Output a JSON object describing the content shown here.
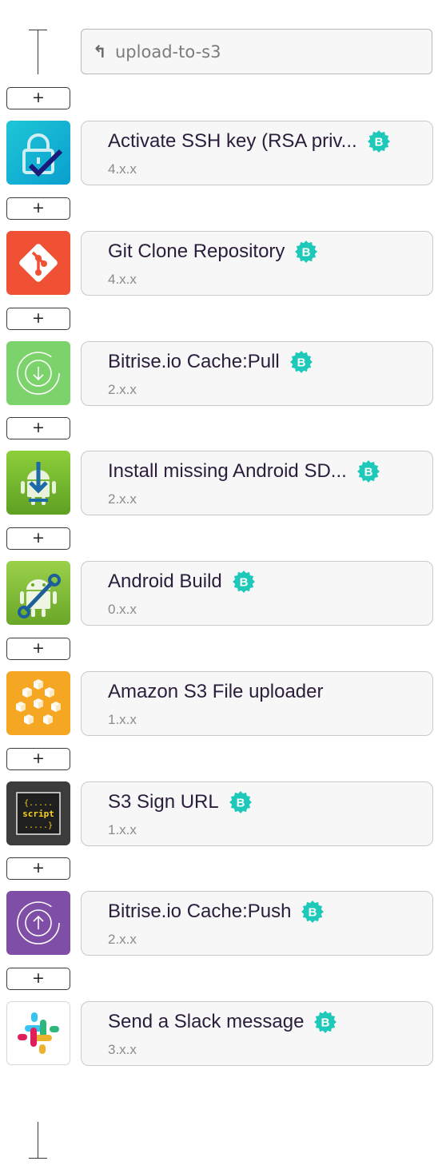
{
  "workflow": {
    "name": "upload-to-s3",
    "trigger_icon": "↰"
  },
  "add_button_label": "+",
  "badge_letter": "B",
  "badge_color": "#1ec9b9",
  "steps": [
    {
      "title": "Activate SSH key (RSA priv...",
      "version": "4.x.x",
      "verified": true,
      "icon": "lock-check-icon",
      "icon_color": "#12b8d4"
    },
    {
      "title": "Git Clone Repository",
      "version": "4.x.x",
      "verified": true,
      "icon": "git-icon",
      "icon_color": "#f05033"
    },
    {
      "title": "Bitrise.io Cache:Pull",
      "version": "2.x.x",
      "verified": true,
      "icon": "cache-pull-icon",
      "icon_color": "#7dd36b"
    },
    {
      "title": "Install missing Android SD...",
      "version": "2.x.x",
      "verified": true,
      "icon": "android-download-icon",
      "icon_color": "#76b82a"
    },
    {
      "title": "Android Build",
      "version": "0.x.x",
      "verified": true,
      "icon": "android-wrench-icon",
      "icon_color": "#8cc63f"
    },
    {
      "title": "Amazon S3 File uploader",
      "version": "1.x.x",
      "verified": false,
      "icon": "aws-s3-icon",
      "icon_color": "#f5a623"
    },
    {
      "title": "S3 Sign URL",
      "version": "1.x.x",
      "verified": true,
      "icon": "script-icon",
      "icon_color": "#3c3c3c",
      "icon_text_top": "{.....",
      "icon_text_mid": "script",
      "icon_text_bot": ".....}"
    },
    {
      "title": "Bitrise.io Cache:Push",
      "version": "2.x.x",
      "verified": true,
      "icon": "cache-push-icon",
      "icon_color": "#7f4ea7"
    },
    {
      "title": "Send a Slack message",
      "version": "3.x.x",
      "verified": true,
      "icon": "slack-icon",
      "icon_color": "#ffffff"
    }
  ]
}
